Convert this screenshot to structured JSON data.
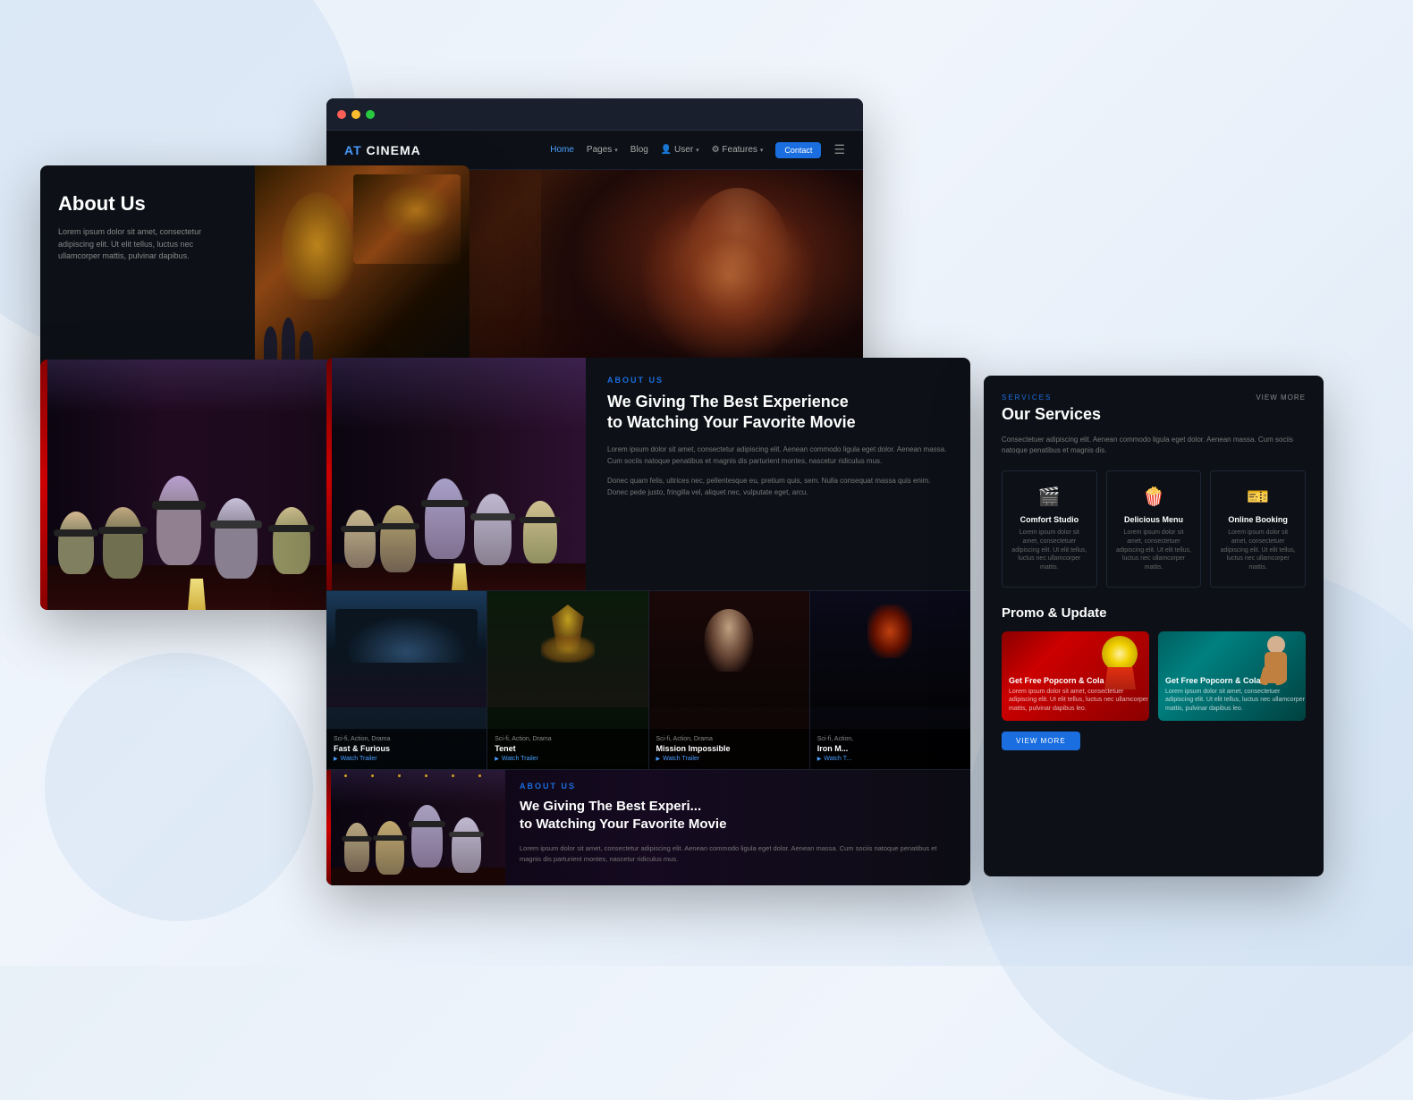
{
  "site": {
    "name": "AT CINEMA",
    "name_prefix": "AT",
    "name_suffix": " CINEMA"
  },
  "nav": {
    "items": [
      {
        "label": "Home",
        "active": true
      },
      {
        "label": "Pages",
        "hasDropdown": true
      },
      {
        "label": "Blog"
      },
      {
        "label": "User",
        "hasDropdown": true
      },
      {
        "label": "Features",
        "hasDropdown": true
      }
    ],
    "contact_btn": "Contact"
  },
  "card_about_us": {
    "title": "About Us",
    "description": "Lorem ipsum dolor sit amet, consectetur adipiscing elit. Ut elit tellus, luctus nec ullamcorper mattis, pulvinar dapibus."
  },
  "card_main": {
    "section_label": "ABOUT US",
    "title_line1": "We Giving The Best Experience",
    "title_line2": "to Watching Your Favorite Movie",
    "description1": "Lorem ipsum dolor sit amet, consectetur adipiscing elit. Aenean commodo ligula eget dolor. Aenean massa. Cum sociis natoque penatibus et magnis dis parturient montes, nascetur ridiculus mus.",
    "description2": "Donec quam felis, ultrices nec, pellentesque eu, pretium quis, sem. Nulla consequat massa quis enim. Donec pede justo, fringilla vel, aliquet nec, vulputate eget, arcu."
  },
  "movies": [
    {
      "genre": "Sci-fi, Action, Drama",
      "title": "Fast & Furious",
      "trailer": "Watch Trailer"
    },
    {
      "genre": "Sci-fi, Action, Drama",
      "title": "Tenet",
      "trailer": "Watch Trailer"
    },
    {
      "genre": "Sci-fi, Action, Drama",
      "title": "Mission Impossible",
      "trailer": "Watch Trailer"
    },
    {
      "genre": "Sci-fi, Action,",
      "title": "Iron M...",
      "trailer": "Watch T..."
    }
  ],
  "services": {
    "label": "SERVICES",
    "title": "Our Services",
    "description": "Consectetuer adipiscing elit. Aenean commodo ligula eget dolor. Aenean massa. Cum sociis natoque penatibus et magnis dis.",
    "view_more": "VIEW MORE",
    "items": [
      {
        "icon": "🎬",
        "name": "Comfort Studio",
        "description": "Lorem ipsum dolor sit amet, consectetuer adipiscing elit. Ut elit tellus, luctus nec ullamcorper mattis."
      },
      {
        "icon": "🍿",
        "name": "Delicious Menu",
        "description": "Lorem ipsum dolor sit amet, consectetuer adipiscing elit. Ut elit tellus, luctus nec ullamcorper mattis."
      },
      {
        "icon": "🎫",
        "name": "Online Booking",
        "description": "Lorem ipsum dolor sit amet, consectetuer adipiscing elit. Ut elit tellus, luctus nec ullamcorper mattis."
      }
    ]
  },
  "promo": {
    "title": "Promo & Update",
    "items": [
      {
        "title": "Get Free Popcorn & Cola",
        "description": "Lorem ipsum dolor sit amet, consectetuer adipiscing elit. Ut elit tellus, luctus nec ullamcorper mattis, pulvinar dapibus leo."
      },
      {
        "title": "Get Free Popcorn & Cola",
        "description": "Lorem ipsum dolor sit amet, consectetuer adipiscing elit. Ut elit tellus, luctus nec ullamcorper mattis, pulvinar dapibus leo."
      }
    ],
    "view_more_btn": "VIEW MORE"
  },
  "card_bottom": {
    "section_label": "ABOUT US",
    "title_line1": "We Giving The Best Experi...",
    "title_line2": "to Watching Your Favorite Movie",
    "description": "Lorem ipsum dolor sit amet, consectetur adipiscing elit. Aenean commodo ligula eget dolor. Aenean massa. Cum sociis natoque penatibus et magnis dis parturient montes, nascetur ridiculus mus."
  },
  "colors": {
    "accent": "#1a6ee0",
    "dark_bg": "#0d1117",
    "darker_bg": "#080c12",
    "text_muted": "#777777",
    "text_light": "#aaaaaa",
    "white": "#ffffff",
    "border": "#1e2535"
  }
}
